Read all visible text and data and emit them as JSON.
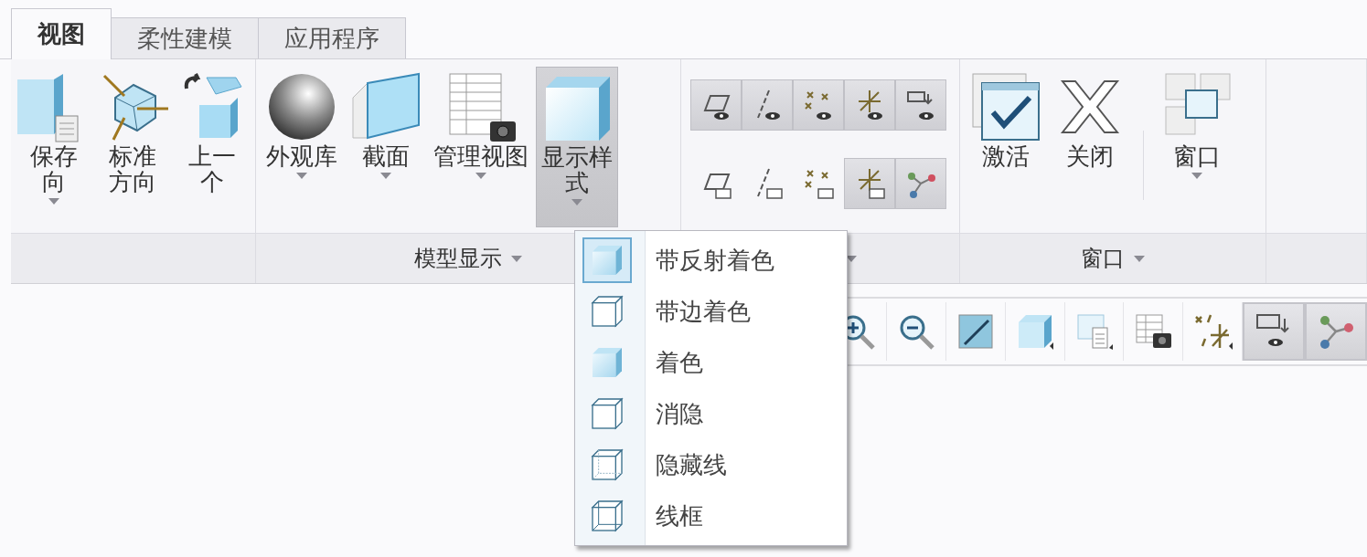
{
  "tabs": [
    {
      "label": "视图",
      "selected": true
    },
    {
      "label": "柔性建模",
      "selected": false
    },
    {
      "label": "应用程序",
      "selected": false
    }
  ],
  "ribbon": {
    "groups": [
      {
        "kind": "large",
        "dropdown": false,
        "buttons": [
          {
            "label": "保存向",
            "dropdown": true,
            "pressed": false,
            "divider": false
          },
          {
            "label": "标准方向",
            "dropdown": false,
            "pressed": false,
            "divider": false
          },
          {
            "label": "上一个",
            "dropdown": false,
            "pressed": false,
            "divider": false
          }
        ]
      },
      {
        "kind": "large",
        "label": "模型显示",
        "dropdown": true,
        "buttons": [
          {
            "label": "外观库",
            "dropdown": true,
            "pressed": false,
            "divider": false
          },
          {
            "label": "截面",
            "dropdown": true,
            "pressed": false,
            "divider": false
          },
          {
            "label": "管理视图",
            "dropdown": true,
            "pressed": false,
            "divider": false
          },
          {
            "label": "显示样式",
            "dropdown": true,
            "pressed": true,
            "divider": false
          }
        ]
      },
      {
        "kind": "grid",
        "dropdown": true,
        "buttons": [
          {
            "pressed": true
          },
          {
            "pressed": true
          },
          {
            "pressed": true
          },
          {
            "pressed": true
          },
          {
            "pressed": true
          },
          {
            "pressed": false
          },
          {
            "pressed": false
          },
          {
            "pressed": false
          },
          {
            "pressed": true
          },
          {
            "pressed": true
          }
        ]
      },
      {
        "kind": "large",
        "label": "窗口",
        "dropdown": true,
        "buttons": [
          {
            "label": "激活",
            "dropdown": false,
            "pressed": false,
            "divider": false
          },
          {
            "label": "关闭",
            "dropdown": false,
            "pressed": false,
            "divider": false
          },
          {
            "label": "窗口",
            "dropdown": true,
            "pressed": false,
            "divider": true
          }
        ]
      }
    ]
  },
  "toolbar": {
    "items": [
      {
        "on": false
      },
      {
        "on": false
      },
      {
        "on": false
      },
      {
        "on": false
      },
      {
        "on": false
      },
      {
        "on": false
      },
      {
        "on": false
      },
      {
        "on": true
      },
      {
        "on": true
      }
    ]
  },
  "menu": {
    "items": [
      {
        "label": "带反射着色",
        "selected": true
      },
      {
        "label": "带边着色",
        "selected": false
      },
      {
        "label": "着色",
        "selected": false
      },
      {
        "label": "消隐",
        "selected": false
      },
      {
        "label": "隐藏线",
        "selected": false
      },
      {
        "label": "线框",
        "selected": false
      }
    ]
  }
}
